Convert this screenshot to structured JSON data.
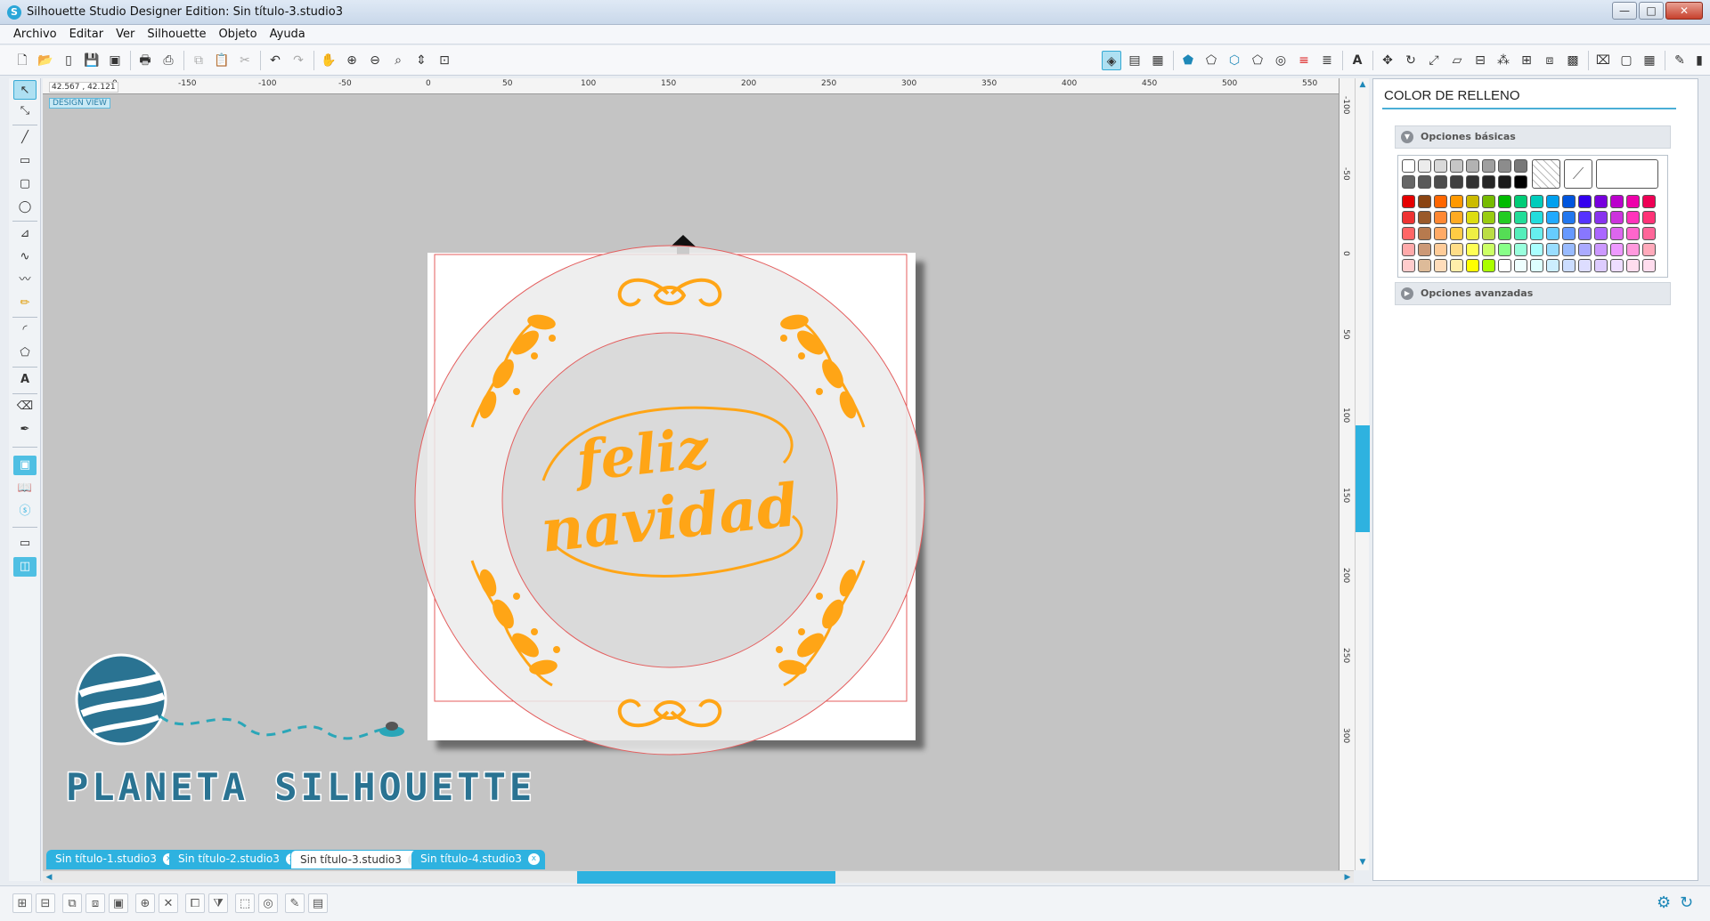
{
  "window": {
    "title": "Silhouette Studio Designer Edition: Sin título-3.studio3",
    "minimize": "—",
    "maximize": "□",
    "close": "✕"
  },
  "menu": [
    "Archivo",
    "Editar",
    "Ver",
    "Silhouette",
    "Objeto",
    "Ayuda"
  ],
  "status": {
    "coordinates": "42.567 , 42.121",
    "view_mode": "DESIGN VIEW"
  },
  "ruler": {
    "h_ticks": [
      "0",
      "-150",
      "-100",
      "-50",
      "0",
      "50",
      "100",
      "150",
      "200",
      "250",
      "300",
      "350",
      "400",
      "450",
      "500",
      "550"
    ],
    "v_ticks": [
      "-100",
      "-50",
      "0",
      "50",
      "100",
      "150",
      "200",
      "250",
      "300"
    ]
  },
  "panel": {
    "title": "COLOR DE RELLENO",
    "basic_section": "Opciones básicas",
    "advanced_section": "Opciones avanzadas"
  },
  "palette": {
    "grays_row1": [
      "#ffffff",
      "#ececec",
      "#d9d9d9",
      "#c6c6c6",
      "#b2b2b2",
      "#9f9f9f",
      "#8c8c8c",
      "#787878"
    ],
    "grays_row2": [
      "#666666",
      "#595959",
      "#4d4d4d",
      "#404040",
      "#333333",
      "#262626",
      "#1a1a1a",
      "#000000"
    ],
    "color_rows": [
      [
        "#e60000",
        "#8b4513",
        "#ff6600",
        "#ff9900",
        "#ccbb00",
        "#77bb00",
        "#00bb00",
        "#00cc77",
        "#00ccbb",
        "#00a0ee",
        "#0055dd",
        "#3300ee",
        "#7700dd",
        "#bb00cc",
        "#ee00aa",
        "#ee0055"
      ],
      [
        "#ee3333",
        "#9a5a2a",
        "#ff8833",
        "#ffaa22",
        "#dddd11",
        "#99cc11",
        "#22cc22",
        "#22dd99",
        "#22dddd",
        "#22aaff",
        "#2277ee",
        "#5533ff",
        "#8833ee",
        "#cc33dd",
        "#ff33bb",
        "#ff3377"
      ],
      [
        "#ff6666",
        "#b77a4e",
        "#ffaa66",
        "#ffcc44",
        "#eeee44",
        "#bbdd44",
        "#55dd55",
        "#55eebb",
        "#66eeee",
        "#66ccff",
        "#6699ff",
        "#8877ff",
        "#aa66ff",
        "#dd66ee",
        "#ff66cc",
        "#ff6699"
      ],
      [
        "#ffaaaa",
        "#cc9977",
        "#ffcc99",
        "#ffdd88",
        "#ffff55",
        "#ccff66",
        "#88ff88",
        "#99ffdd",
        "#aaffff",
        "#99ddff",
        "#99bbff",
        "#aaaaff",
        "#cc99ff",
        "#ee99ff",
        "#ff99dd",
        "#ffaabb"
      ],
      [
        "#ffcccc",
        "#ddbb99",
        "#ffddbb",
        "#ffeeaa",
        "#ffff00",
        "#aaff00",
        "#ffffff",
        "#eeffff",
        "#ddffff",
        "#cceeff",
        "#ccddff",
        "#ddddff",
        "#ddccff",
        "#eeddff",
        "#ffddee",
        "#ffddee"
      ]
    ]
  },
  "tabs": [
    {
      "label": "Sin título-1.studio3",
      "selected": false
    },
    {
      "label": "Sin título-2.studio3",
      "selected": false
    },
    {
      "label": "Sin título-3.studio3",
      "selected": true
    },
    {
      "label": "Sin título-4.studio3",
      "selected": false
    }
  ],
  "design": {
    "accent_color": "#ffa516",
    "line_color": "#e45d5d",
    "word1": "feliz",
    "word2": "navidad"
  },
  "logo_text": "PLANETA SILHOUETTE",
  "colors": {
    "accent": "#2eb2e0",
    "canvas": "#c4c4c4"
  }
}
